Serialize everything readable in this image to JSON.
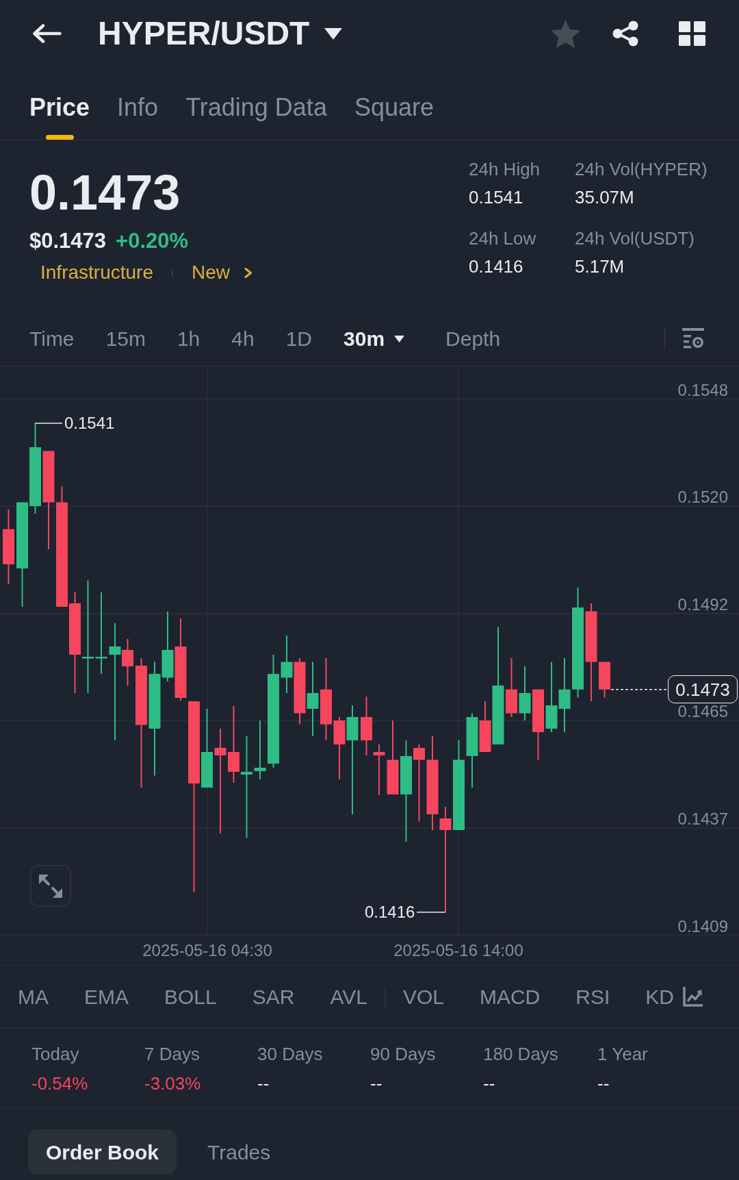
{
  "header": {
    "title": "HYPER/USDT",
    "starred": false
  },
  "tabs": [
    {
      "label": "Price",
      "selected": true
    },
    {
      "label": "Info",
      "selected": false
    },
    {
      "label": "Trading Data",
      "selected": false
    },
    {
      "label": "Square",
      "selected": false
    }
  ],
  "price": {
    "last": "0.1473",
    "usd": "$0.1473",
    "change": {
      "text": "+0.20%",
      "color": "#2ebd85"
    },
    "tags": [
      "Infrastructure",
      "New"
    ]
  },
  "stats": [
    {
      "label": "24h High",
      "value": "0.1541"
    },
    {
      "label": "24h Vol(HYPER)",
      "value": "35.07M"
    },
    {
      "label": "24h Low",
      "value": "0.1416"
    },
    {
      "label": "24h Vol(USDT)",
      "value": "5.17M"
    }
  ],
  "intervals": [
    {
      "label": "Time",
      "kind": "option",
      "selected": false
    },
    {
      "label": "15m",
      "kind": "option",
      "selected": false
    },
    {
      "label": "1h",
      "kind": "option",
      "selected": false
    },
    {
      "label": "4h",
      "kind": "option",
      "selected": false
    },
    {
      "label": "1D",
      "kind": "option",
      "selected": false
    },
    {
      "label": "30m",
      "kind": "menu",
      "selected": true
    },
    {
      "label": "Depth",
      "kind": "option",
      "selected": false
    }
  ],
  "chart": {
    "y_ticks": [
      "0.1548",
      "0.1520",
      "0.1492",
      "0.1465",
      "0.1437",
      "0.1409"
    ],
    "x_ticks": [
      "2025-05-16 04:30",
      "2025-05-16 14:00"
    ],
    "high_label": "0.1541",
    "low_label": "0.1416",
    "last_price": "0.1473"
  },
  "indicators": {
    "main": [
      "MA",
      "EMA",
      "BOLL",
      "SAR",
      "AVL"
    ],
    "sub": [
      "VOL",
      "MACD",
      "RSI",
      "KD"
    ]
  },
  "performance": [
    {
      "label": "Today",
      "value": "-0.54%",
      "color": "#f6465d"
    },
    {
      "label": "7 Days",
      "value": "-3.03%",
      "color": "#f6465d"
    },
    {
      "label": "30 Days",
      "value": "--",
      "color": "#eaecef"
    },
    {
      "label": "90 Days",
      "value": "--",
      "color": "#eaecef"
    },
    {
      "label": "180 Days",
      "value": "--",
      "color": "#eaecef"
    },
    {
      "label": "1 Year",
      "value": "--",
      "color": "#eaecef"
    }
  ],
  "bottom_tabs": [
    {
      "label": "Order Book",
      "selected": true
    },
    {
      "label": "Trades",
      "selected": false
    }
  ]
}
